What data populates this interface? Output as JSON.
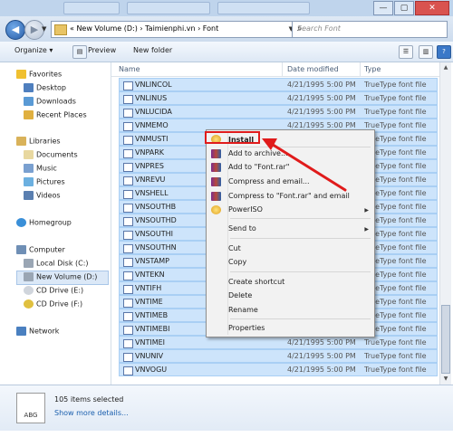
{
  "window": {
    "minimize": "—",
    "maximize": "▢",
    "close": "✕"
  },
  "address": {
    "crumbs": "« New Volume (D:) › Taimienphi.vn › Font",
    "search_placeholder": "Search Font"
  },
  "toolbar": {
    "organize": "Organize ▾",
    "preview": "Preview",
    "new_folder": "New folder"
  },
  "sidebar": {
    "favorites": "Favorites",
    "desktop": "Desktop",
    "downloads": "Downloads",
    "recent": "Recent Places",
    "libraries": "Libraries",
    "documents": "Documents",
    "music": "Music",
    "pictures": "Pictures",
    "videos": "Videos",
    "homegroup": "Homegroup",
    "computer": "Computer",
    "local_c": "Local Disk (C:)",
    "new_volume": "New Volume (D:)",
    "cd_e": "CD Drive (E:)",
    "cd_f": "CD Drive (F:)",
    "network": "Network"
  },
  "columns": {
    "name": "Name",
    "date": "Date modified",
    "type": "Type"
  },
  "files": [
    {
      "name": "VNLINCOL",
      "date": "4/21/1995 5:00 PM",
      "type": "TrueType font file"
    },
    {
      "name": "VNLINUS",
      "date": "4/21/1995 5:00 PM",
      "type": "TrueType font file"
    },
    {
      "name": "VNLUCIDA",
      "date": "4/21/1995 5:00 PM",
      "type": "TrueType font file"
    },
    {
      "name": "VNMEMO",
      "date": "4/21/1995 5:00 PM",
      "type": "TrueType font file"
    },
    {
      "name": "VNMUSTI",
      "date": "",
      "type": "TrueType font file"
    },
    {
      "name": "VNPARK",
      "date": "",
      "type": "TrueType font file"
    },
    {
      "name": "VNPRES",
      "date": "",
      "type": "TrueType font file"
    },
    {
      "name": "VNREVU",
      "date": "",
      "type": "TrueType font file"
    },
    {
      "name": "VNSHELL",
      "date": "",
      "type": "TrueType font file"
    },
    {
      "name": "VNSOUTHB",
      "date": "",
      "type": "TrueType font file"
    },
    {
      "name": "VNSOUTHD",
      "date": "",
      "type": "TrueType font file"
    },
    {
      "name": "VNSOUTHI",
      "date": "",
      "type": "TrueType font file"
    },
    {
      "name": "VNSOUTHN",
      "date": "",
      "type": "TrueType font file"
    },
    {
      "name": "VNSTAMP",
      "date": "",
      "type": "TrueType font file"
    },
    {
      "name": "VNTEKN",
      "date": "",
      "type": "TrueType font file"
    },
    {
      "name": "VNTIFH",
      "date": "",
      "type": "TrueType font file"
    },
    {
      "name": "VNTIME",
      "date": "",
      "type": "TrueType font file"
    },
    {
      "name": "VNTIMEB",
      "date": "",
      "type": "TrueType font file"
    },
    {
      "name": "VNTIMEBI",
      "date": "",
      "type": "TrueType font file"
    },
    {
      "name": "VNTIMEI",
      "date": "4/21/1995 5:00 PM",
      "type": "TrueType font file"
    },
    {
      "name": "VNUNIV",
      "date": "4/21/1995 5:00 PM",
      "type": "TrueType font file"
    },
    {
      "name": "VNVOGU",
      "date": "4/21/1995 5:00 PM",
      "type": "TrueType font file"
    }
  ],
  "menu": {
    "install": "Install",
    "add_archive": "Add to archive...",
    "add_rar": "Add to \"Font.rar\"",
    "compress_email": "Compress and email...",
    "compress_rar_email": "Compress to \"Font.rar\" and email",
    "poweriso": "PowerISO",
    "send_to": "Send to",
    "cut": "Cut",
    "copy": "Copy",
    "create_shortcut": "Create shortcut",
    "delete": "Delete",
    "rename": "Rename",
    "properties": "Properties"
  },
  "details": {
    "icon_text": "ABG",
    "count": "105 items selected",
    "more": "Show more details..."
  },
  "colors": {
    "selection": "#cde4fb",
    "highlight": "#e01b1b",
    "accent": "#1b5fae"
  }
}
